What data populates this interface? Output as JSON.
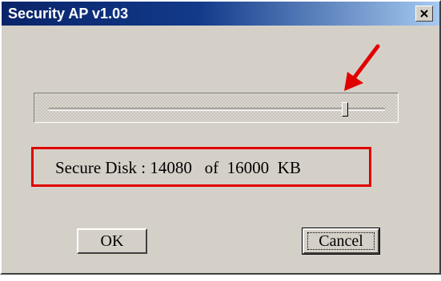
{
  "window": {
    "title": "Security AP v1.03"
  },
  "slider": {
    "fraction": 0.88
  },
  "readout": {
    "label": "Secure Disk : ",
    "value": "14080",
    "of": "of",
    "total": "16000",
    "unit": "KB"
  },
  "buttons": {
    "ok": "OK",
    "cancel": "Cancel"
  },
  "colors": {
    "highlight": "#e00000",
    "titlebar": "#0a246a"
  },
  "icons": {
    "close": "close-icon",
    "annotation": "arrow-icon"
  }
}
